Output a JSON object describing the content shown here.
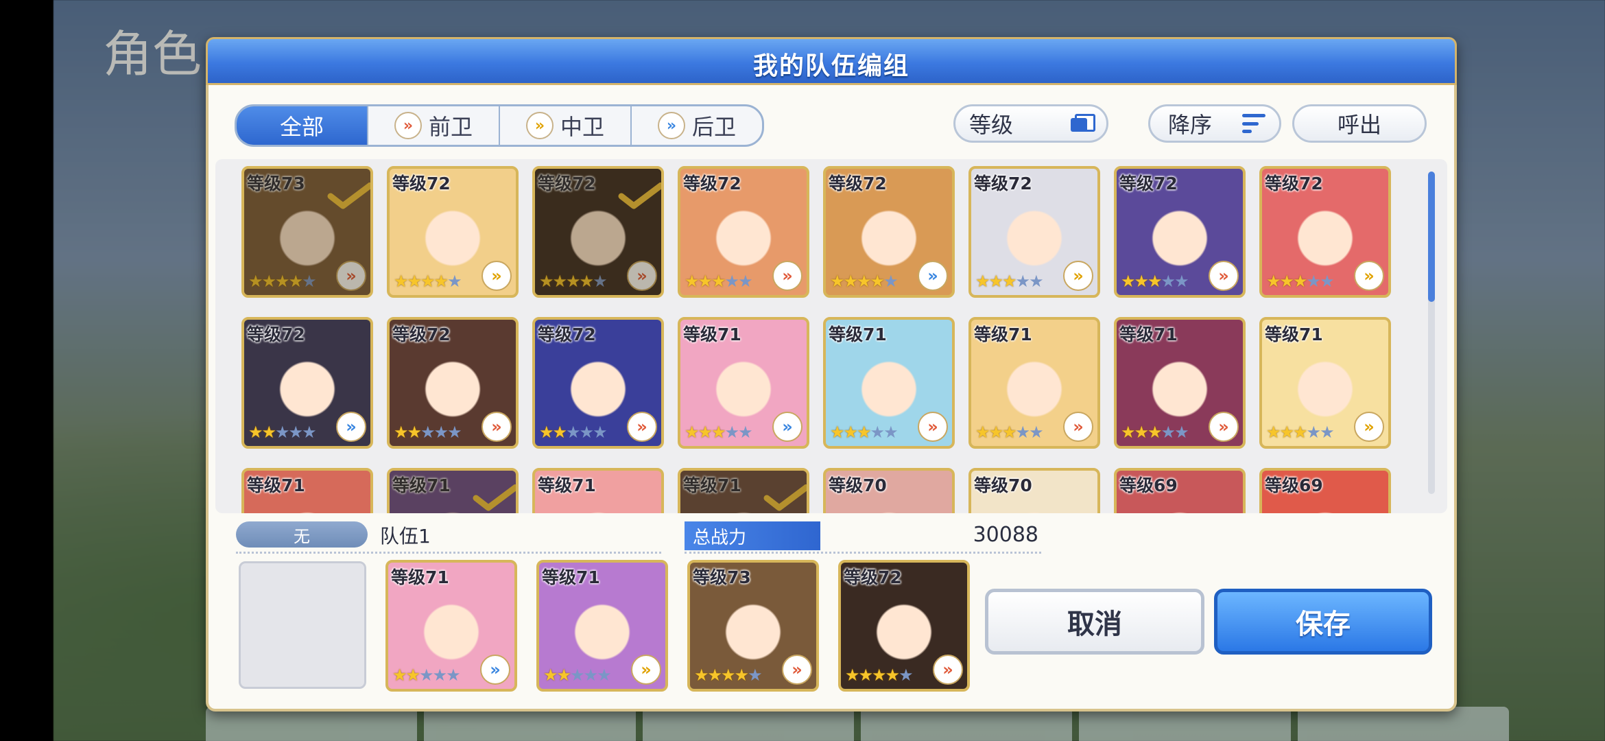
{
  "background": {
    "title": "角色"
  },
  "dialog": {
    "title": "我的队伍编组"
  },
  "filters": [
    {
      "label": "全部",
      "active": true,
      "icon": ""
    },
    {
      "label": "前卫",
      "active": false,
      "icon": "red"
    },
    {
      "label": "中卫",
      "active": false,
      "icon": "yellow"
    },
    {
      "label": "后卫",
      "active": false,
      "icon": "blue"
    }
  ],
  "sort": {
    "field": "等级",
    "order": "降序",
    "call": "呼出"
  },
  "characters": [
    {
      "level": "等级73",
      "stars": 4,
      "role": "red",
      "selected": true,
      "color": "#7a5a3a"
    },
    {
      "level": "等级72",
      "stars": 4,
      "role": "yellow",
      "selected": false,
      "color": "#f2cf8a"
    },
    {
      "level": "等级72",
      "stars": 4,
      "role": "red",
      "selected": true,
      "color": "#3a2a22"
    },
    {
      "level": "等级72",
      "stars": 3,
      "role": "red",
      "selected": false,
      "color": "#e79a6a"
    },
    {
      "level": "等级72",
      "stars": 4,
      "role": "blue",
      "selected": false,
      "color": "#d99a55"
    },
    {
      "level": "等级72",
      "stars": 3,
      "role": "yellow",
      "selected": false,
      "color": "#dedee6"
    },
    {
      "level": "等级72",
      "stars": 3,
      "role": "red",
      "selected": false,
      "color": "#5b4a9a"
    },
    {
      "level": "等级72",
      "stars": 3,
      "role": "yellow",
      "selected": false,
      "color": "#e46a6a"
    },
    {
      "level": "等级72",
      "stars": 2,
      "role": "blue",
      "selected": false,
      "color": "#3a3548"
    },
    {
      "level": "等级72",
      "stars": 2,
      "role": "red",
      "selected": false,
      "color": "#5a3a30"
    },
    {
      "level": "等级72",
      "stars": 2,
      "role": "red",
      "selected": false,
      "color": "#3a3f9a"
    },
    {
      "level": "等级71",
      "stars": 3,
      "role": "blue",
      "selected": false,
      "color": "#f1a6c2"
    },
    {
      "level": "等级71",
      "stars": 3,
      "role": "red",
      "selected": false,
      "color": "#9fd6ea"
    },
    {
      "level": "等级71",
      "stars": 3,
      "role": "red",
      "selected": false,
      "color": "#f3d08a"
    },
    {
      "level": "等级71",
      "stars": 3,
      "role": "red",
      "selected": false,
      "color": "#8a3a5a"
    },
    {
      "level": "等级71",
      "stars": 3,
      "role": "yellow",
      "selected": false,
      "color": "#f7e0a0"
    },
    {
      "level": "等级71",
      "stars": 0,
      "role": "",
      "selected": false,
      "color": "#d66a5a"
    },
    {
      "level": "等级71",
      "stars": 0,
      "role": "",
      "selected": true,
      "color": "#6a4a8a"
    },
    {
      "level": "等级71",
      "stars": 0,
      "role": "",
      "selected": false,
      "color": "#f0a0a0"
    },
    {
      "level": "等级71",
      "stars": 0,
      "role": "",
      "selected": true,
      "color": "#6a4a40"
    },
    {
      "level": "等级70",
      "stars": 0,
      "role": "",
      "selected": false,
      "color": "#e0a8a0"
    },
    {
      "level": "等级70",
      "stars": 0,
      "role": "",
      "selected": false,
      "color": "#f2e4c8"
    },
    {
      "level": "等级69",
      "stars": 0,
      "role": "",
      "selected": false,
      "color": "#c8585a"
    },
    {
      "level": "等级69",
      "stars": 0,
      "role": "",
      "selected": false,
      "color": "#e05a4a"
    }
  ],
  "team": {
    "badge": "无",
    "name": "队伍1",
    "power_label": "总战力",
    "power_value": "30088",
    "members": [
      {
        "level": "等级71",
        "stars": 2,
        "role": "blue",
        "color": "#f1a6c2"
      },
      {
        "level": "等级71",
        "stars": 2,
        "role": "yellow",
        "color": "#b77ad0"
      },
      {
        "level": "等级73",
        "stars": 4,
        "role": "red",
        "color": "#7a5a3a"
      },
      {
        "level": "等级72",
        "stars": 4,
        "role": "red",
        "color": "#3a2a22"
      }
    ]
  },
  "buttons": {
    "cancel": "取消",
    "save": "保存"
  }
}
